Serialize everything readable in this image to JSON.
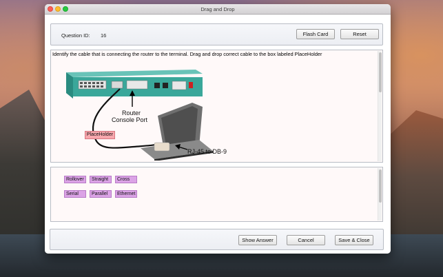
{
  "window": {
    "title": "Drag and Drop"
  },
  "header": {
    "question_id_label": "Question ID:",
    "question_id_value": "16",
    "flash_card_label": "Flash Card",
    "reset_label": "Reset"
  },
  "question": {
    "text": "Identify the cable that is connecting the router to the terminal. Drag and drop correct cable to the box labeled PlaceHolder",
    "image_labels": {
      "router_console_port_line1": "Router",
      "router_console_port_line2": "Console Port",
      "rj45": "RJ-45 to DB-9"
    },
    "placeholder_label": "PlaceHolder"
  },
  "answers": {
    "options": [
      "Rollover",
      "Straight",
      "Cross",
      "Serial",
      "Parallel",
      "Ethernet"
    ]
  },
  "footer": {
    "show_answer_label": "Show Answer",
    "cancel_label": "Cancel",
    "save_close_label": "Save & Close"
  },
  "colors": {
    "placeholder_fill": "#f7a7ad",
    "chip_fill": "#dba3e6",
    "router_body": "#3aa79a"
  }
}
